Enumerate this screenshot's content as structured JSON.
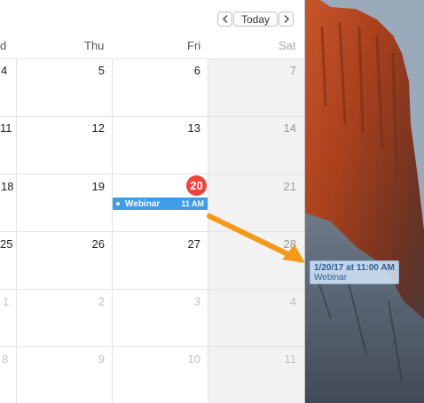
{
  "toolbar": {
    "prev_label": "<",
    "today_label": "Today",
    "next_label": ">"
  },
  "day_headers": [
    "d",
    "Thu",
    "Fri",
    "Sat"
  ],
  "weeks": [
    {
      "wed": "4",
      "thu": "5",
      "fri": "6",
      "sat": "7"
    },
    {
      "wed": "11",
      "thu": "12",
      "fri": "13",
      "sat": "14"
    },
    {
      "wed": "18",
      "thu": "19",
      "fri": "20",
      "sat": "21"
    },
    {
      "wed": "25",
      "thu": "26",
      "fri": "27",
      "sat": "28"
    },
    {
      "wed": "1",
      "thu": "2",
      "fri": "3",
      "sat": "4"
    },
    {
      "wed": "8",
      "thu": "9",
      "fri": "10",
      "sat": "11"
    }
  ],
  "event": {
    "name": "Webinar",
    "time": "11 AM",
    "color": "#3f9ce8"
  },
  "drag_ghost": {
    "datetime": "1/20/17 at 11:00 AM",
    "name": "Webinar"
  },
  "colors": {
    "today": "#f0433a",
    "arrow": "#f39a1a"
  }
}
